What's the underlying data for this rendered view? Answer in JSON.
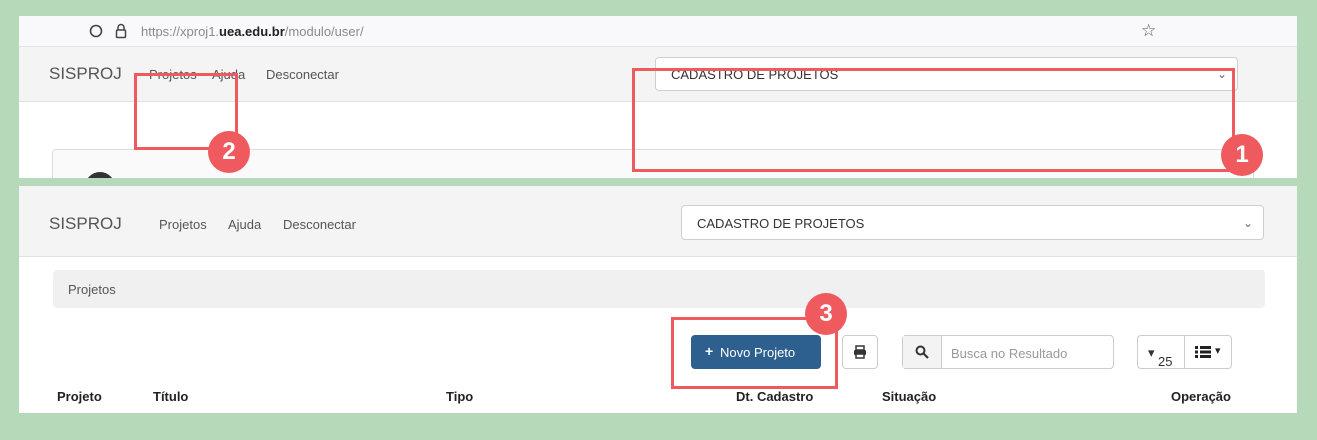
{
  "browser": {
    "url_prefix": "https://xproj1.",
    "url_domain": "uea.edu.br",
    "url_path": "/modulo/user/"
  },
  "navbar": {
    "brand": "SISPROJ",
    "links": [
      "Projetos",
      "Ajuda",
      "Desconectar"
    ],
    "module_select": "CADASTRO DE PROJETOS"
  },
  "breadcrumb": {
    "label": "Projetos"
  },
  "toolbar": {
    "new_project": "Novo Projeto",
    "search_placeholder": "Busca no Resultado",
    "page_size": "25"
  },
  "table": {
    "headers": [
      "Projeto",
      "Título",
      "Tipo",
      "Dt. Cadastro",
      "Situação",
      "Operação"
    ]
  },
  "annotations": {
    "badges": [
      "1",
      "2",
      "3"
    ],
    "color": "#ef5a5f"
  },
  "colors": {
    "background": "#b5d9b9",
    "primary_button": "#2d5f8f"
  }
}
